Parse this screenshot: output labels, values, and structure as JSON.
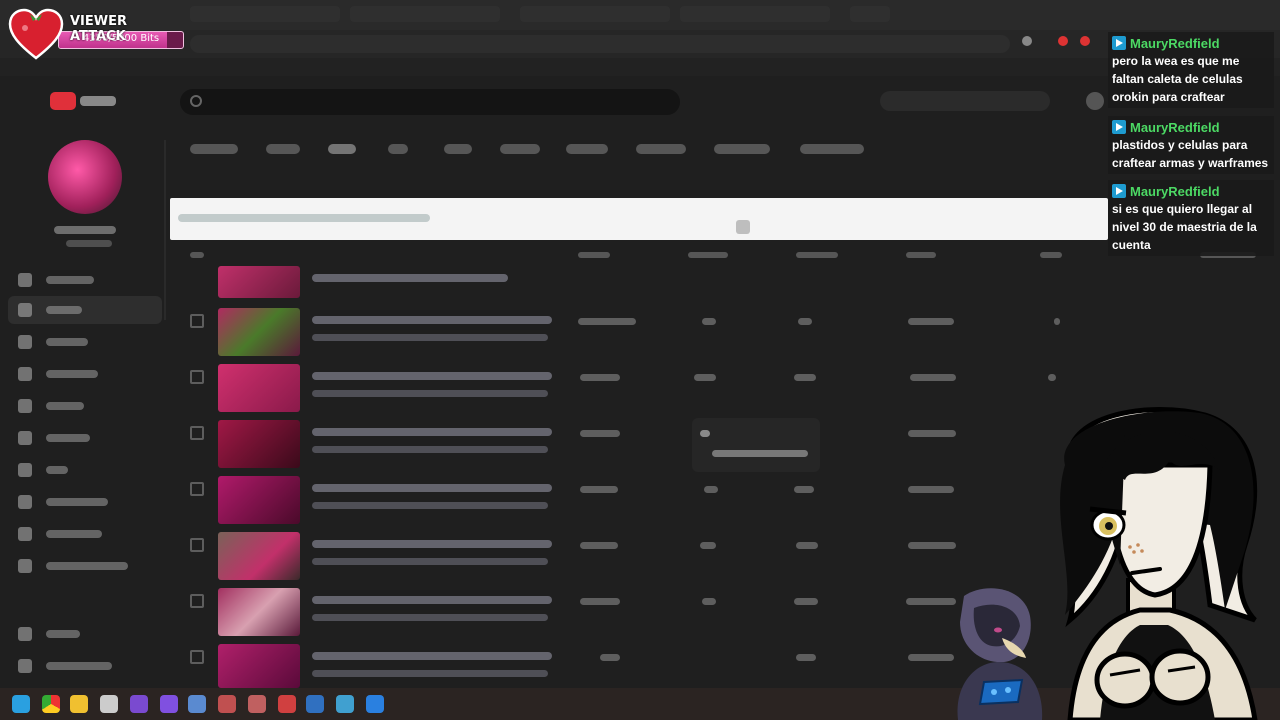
{
  "viewer_attack": {
    "title": "VIEWER ATTACK",
    "bits_text": "4350/5000 Bits",
    "progress_fraction": 0.87,
    "heart_color": "#d8202f",
    "bar_color": "#d94aa5"
  },
  "chat": {
    "username_color": "#4cd964",
    "messages": [
      {
        "user": "MauryRedfield",
        "text": "pero la wea es que me faltan caleta de celulas orokin para craftear"
      },
      {
        "user": "MauryRedfield",
        "text": "plastidos y celulas para craftear armas y warframes"
      },
      {
        "user": "MauryRedfield",
        "text": "si es que quiero llegar al nivel 30 de maestria de la cuenta"
      }
    ]
  },
  "colors": {
    "page_background": "#1f1f1f",
    "filter_bar": "#f4f4f4",
    "brand_red": "#e0303a",
    "thumbnail_pinks": [
      "#c0306a",
      "#b02a60",
      "#d0306e",
      "#a01846",
      "#b01a6a",
      "#7a6258",
      "#a23060",
      "#b0206a"
    ]
  },
  "icons": {
    "browser_extensions": [
      "extension-icon",
      "extension-icon",
      "extension-icon"
    ],
    "sidebar": [
      "dashboard-icon",
      "content-icon",
      "analytics-icon",
      "comments-icon",
      "subtitles-icon",
      "copyright-icon",
      "earn-icon",
      "customization-icon",
      "audio-library-icon",
      "settings-icon",
      "feedback-icon"
    ],
    "taskbar": [
      "start-icon",
      "chrome-icon",
      "files-icon",
      "app-icon",
      "app-icon",
      "app-icon",
      "app-icon",
      "app-icon",
      "app-icon",
      "app-icon",
      "app-icon",
      "app-icon"
    ]
  },
  "video_rows_count": 8
}
